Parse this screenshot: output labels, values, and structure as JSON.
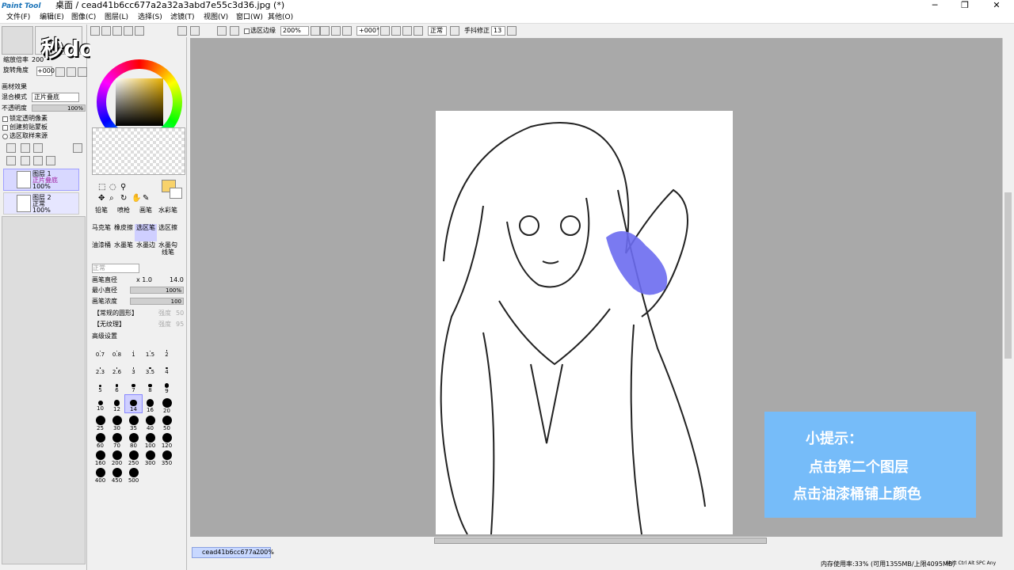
{
  "app": {
    "logo_text": "Paint Tool SAI",
    "window_title": "桌面 / cead41b6cc677a2a32a3abd7e55c3d36.jpg (*)",
    "watermark": "秒dong视频"
  },
  "menu": [
    "文件(F)",
    "编辑(E)",
    "图像(C)",
    "图层(L)",
    "选择(S)",
    "滤镜(T)",
    "视图(V)",
    "窗口(W)",
    "其他(O)"
  ],
  "toolbar": {
    "selection_edge_label": "选区边缘",
    "zoom": "200%",
    "rotation": "+000°",
    "blend": "正常",
    "stabilizer_label": "手抖修正",
    "stabilizer_value": "13"
  },
  "navigator": {
    "zoom_label": "缩放倍率",
    "zoom_value": "200",
    "rotate_label": "旋转角度",
    "rotate_value": "+000"
  },
  "layer_props": {
    "effect_label": "画材效果",
    "blend_label": "混合模式",
    "blend_value": "正片叠底",
    "opacity_label": "不透明度",
    "opacity_value": "100%",
    "lock_alpha": "锁定透明像素",
    "clip": "创建剪贴蒙板",
    "sample": "选区取样来源"
  },
  "layers": [
    {
      "name": "图层 1",
      "mode": "正片叠底",
      "opacity": "100%"
    },
    {
      "name": "图层 2",
      "mode": "正常",
      "opacity": "100%"
    }
  ],
  "tools": {
    "row1": [
      "铅笔",
      "喷枪",
      "画笔",
      "水彩笔"
    ],
    "row2": [
      "马克笔",
      "橡皮擦",
      "选区笔",
      "选区擦"
    ],
    "row3": [
      "油漆桶",
      "水墨笔",
      "水墨边",
      "水墨勾线笔"
    ]
  },
  "brush": {
    "mode": "正常",
    "size_label": "画笔直径",
    "size_mult": "x 1.0",
    "size_value": "14.0",
    "min_label": "最小直径",
    "min_value": "100%",
    "density_label": "画笔浓度",
    "density_value": "100",
    "shape": "【常规的圆形】",
    "shape_strength": "强度",
    "shape_value": "50",
    "texture": "【无纹理】",
    "texture_strength": "强度",
    "texture_value": "95",
    "advanced": "高级设置"
  },
  "brush_sizes": [
    "0.7",
    "0.8",
    "1",
    "1.5",
    "2",
    "2.3",
    "2.6",
    "3",
    "3.5",
    "4",
    "5",
    "6",
    "7",
    "8",
    "9",
    "10",
    "12",
    "14",
    "16",
    "20",
    "25",
    "30",
    "35",
    "40",
    "50",
    "60",
    "70",
    "80",
    "100",
    "120",
    "160",
    "200",
    "250",
    "300",
    "350",
    "400",
    "450",
    "500"
  ],
  "hint": {
    "title": "小提示：",
    "line1": "点击第二个图层",
    "line2": "点击油漆桶铺上颜色"
  },
  "status": {
    "tab": "cead41b6cc677a...",
    "tab_zoom": "200%",
    "memory": "内存使用率:33% (可用1355MB/上限4095MB)",
    "keys": "Shift Ctrl Alt SPC Any"
  },
  "colors": {
    "fill_color": "#6b6bf0",
    "hint_bg": "#76bcf9",
    "primary": "#f8d26b"
  }
}
